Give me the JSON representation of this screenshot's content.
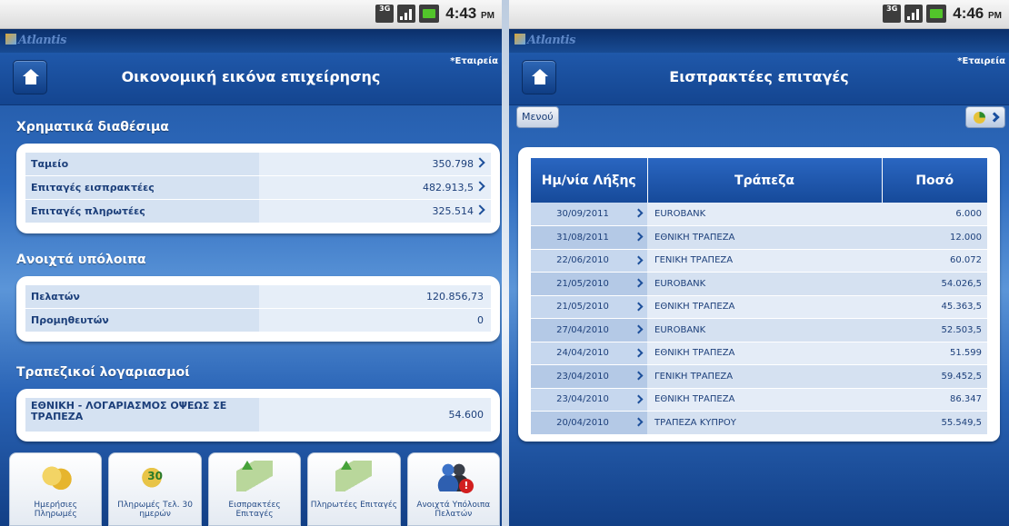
{
  "status_left": {
    "clock": "4:43",
    "ampm": "PM",
    "network": "3G"
  },
  "status_right": {
    "clock": "4:46",
    "ampm": "PM",
    "network": "3G"
  },
  "brand": "Atlantis",
  "screen1": {
    "title": "Οικονομική εικόνα επιχείρησης",
    "company": "*Εταιρεία",
    "sections": [
      {
        "heading": "Χρηματικά διαθέσιμα",
        "rows": [
          {
            "label": "Ταμείο",
            "value": "350.798"
          },
          {
            "label": "Επιταγές εισπρακτέες",
            "value": "482.913,5"
          },
          {
            "label": "Επιταγές πληρωτέες",
            "value": "325.514"
          }
        ]
      },
      {
        "heading": "Ανοιχτά υπόλοιπα",
        "rows": [
          {
            "label": "Πελατών",
            "value": "120.856,73"
          },
          {
            "label": "Προμηθευτών",
            "value": "0"
          }
        ]
      },
      {
        "heading": "Τραπεζικοί λογαριασμοί",
        "rows": [
          {
            "label": "ΕΘΝΙΚΗ - ΛΟΓΑΡΙΑΣΜΟΣ ΟΨΕΩΣ ΣΕ ΤΡΑΠΕΖΑ",
            "value": "54.600"
          }
        ]
      }
    ],
    "tiles": [
      {
        "label": "Ημερήσιες Πληρωμές",
        "icon": "coins-icon"
      },
      {
        "label": "Πληρωμές Τελ. 30 ημερών",
        "icon": "coins-30-icon",
        "badge": "30"
      },
      {
        "label": "Εισπρακτέες Επιταγές",
        "icon": "money-in-icon"
      },
      {
        "label": "Πληρωτέες Επιταγές",
        "icon": "money-out-icon"
      },
      {
        "label": "Ανοιχτά Υπόλοιπα Πελατών",
        "icon": "customers-alert-icon",
        "badge": "!"
      }
    ]
  },
  "screen2": {
    "title": "Εισπρακτέες επιταγές",
    "company": "*Εταιρεία",
    "menu_label": "Μενού",
    "columns": [
      "Ημ/νία Λήξης",
      "Τράπεζα",
      "Ποσό"
    ],
    "rows": [
      {
        "date": "30/09/2011",
        "bank": "EUROBANK",
        "amount": "6.000"
      },
      {
        "date": "31/08/2011",
        "bank": "ΕΘΝΙΚΗ ΤΡΑΠΕΖΑ",
        "amount": "12.000"
      },
      {
        "date": "22/06/2010",
        "bank": "ΓΕΝΙΚΗ ΤΡΑΠΕΖΑ",
        "amount": "60.072"
      },
      {
        "date": "21/05/2010",
        "bank": "EUROBANK",
        "amount": "54.026,5"
      },
      {
        "date": "21/05/2010",
        "bank": "ΕΘΝΙΚΗ ΤΡΑΠΕΖΑ",
        "amount": "45.363,5"
      },
      {
        "date": "27/04/2010",
        "bank": "EUROBANK",
        "amount": "52.503,5"
      },
      {
        "date": "24/04/2010",
        "bank": "ΕΘΝΙΚΗ ΤΡΑΠΕΖΑ",
        "amount": "51.599"
      },
      {
        "date": "23/04/2010",
        "bank": "ΓΕΝΙΚΗ ΤΡΑΠΕΖΑ",
        "amount": "59.452,5"
      },
      {
        "date": "23/04/2010",
        "bank": "ΕΘΝΙΚΗ ΤΡΑΠΕΖΑ",
        "amount": "86.347"
      },
      {
        "date": "20/04/2010",
        "bank": "ΤΡΑΠΕΖΑ ΚΥΠΡΟΥ",
        "amount": "55.549,5"
      }
    ]
  }
}
